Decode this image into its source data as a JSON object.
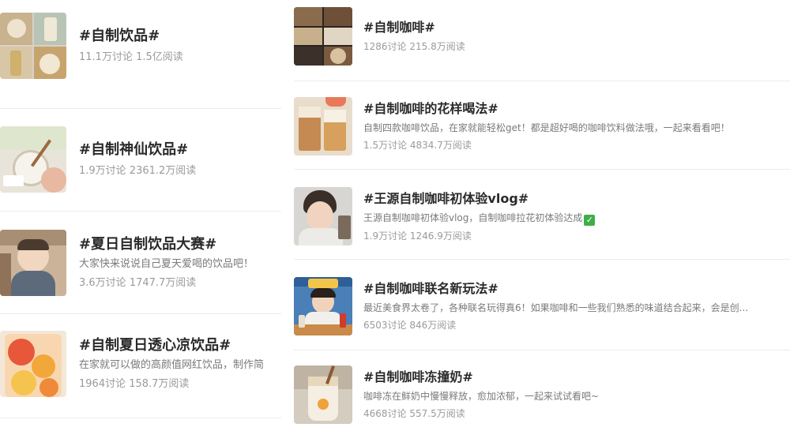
{
  "left_topics": [
    {
      "title": "#自制饮品#",
      "stats": "11.1万讨论 1.5亿阅读",
      "thumb": "drinks-collage-thumbnail"
    },
    {
      "title": "#自制神仙饮品#",
      "stats": "1.9万讨论 2361.2万阅读",
      "thumb": "milk-drink-thumbnail"
    },
    {
      "title": "#夏日自制饮品大赛#",
      "desc": "大家快来说说自己夏天爱喝的饮品吧！",
      "stats": "3.6万讨论 1747.7万阅读",
      "thumb": "baby-photo-thumbnail"
    },
    {
      "title": "#自制夏日透心凉饮品#",
      "desc": "在家就可以做的高颜值网红饮品，制作简",
      "stats": "1964讨论 158.7万阅读",
      "thumb": "citrus-drink-thumbnail"
    }
  ],
  "right_topics": [
    {
      "title": "#自制咖啡#",
      "stats": "1286讨论 215.8万阅读",
      "thumb": "coffee-collage-thumbnail"
    },
    {
      "title": "#自制咖啡的花样喝法#",
      "desc": "自制四款咖啡饮品，在家就能轻松get！都是超好喝的咖啡饮料做法哦，一起来看看吧！",
      "stats": "1.5万讨论 4834.7万阅读",
      "thumb": "coffee-cups-thumbnail"
    },
    {
      "title": "#王源自制咖啡初体验vlog#",
      "desc": "王源自制咖啡初体验vlog，自制咖啡拉花初体验达成",
      "desc_badge": "✓",
      "stats": "1.9万讨论 1246.9万阅读",
      "thumb": "person-vlog-thumbnail"
    },
    {
      "title": "#自制咖啡联名新玩法#",
      "desc": "最近美食界太卷了，各种联名玩得真6！如果咖啡和一些我们熟悉的味道结合起来，会是创...",
      "stats": "6503讨论 846万阅读",
      "thumb": "host-table-thumbnail"
    },
    {
      "title": "#自制咖啡冻撞奶#",
      "desc": "咖啡冻在鲜奶中慢慢释放，愈加浓郁，一起来试试看吧~",
      "stats": "4668讨论 557.5万阅读",
      "thumb": "coffee-jelly-thumbnail"
    }
  ]
}
